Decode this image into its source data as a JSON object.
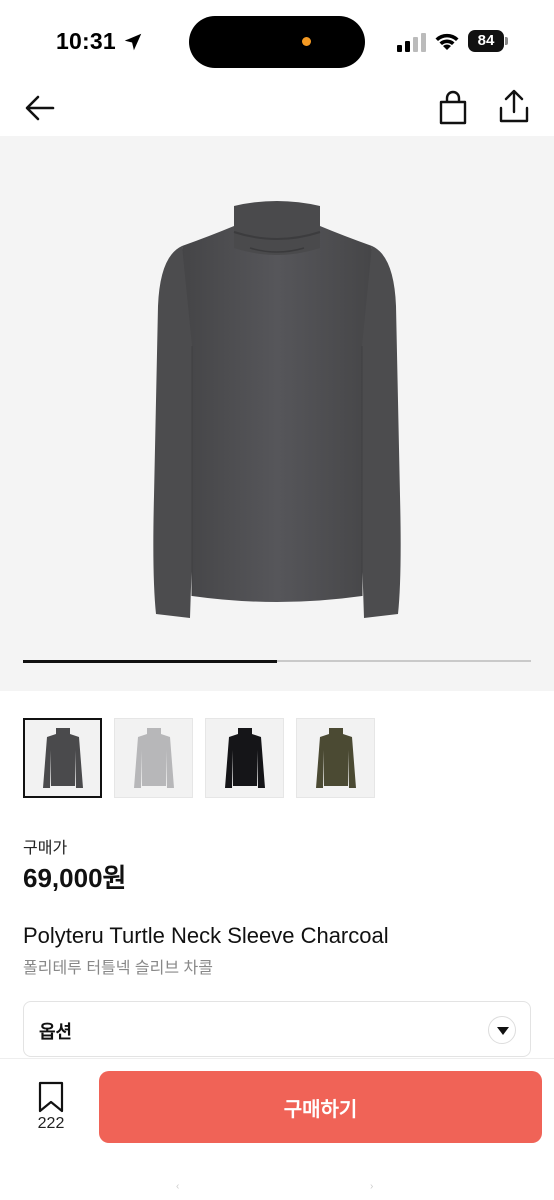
{
  "status_bar": {
    "time": "10:31",
    "battery": "84"
  },
  "header": {
    "back_icon": "arrow-left-icon",
    "bag_icon": "shopping-bag-icon",
    "share_icon": "share-icon"
  },
  "gallery": {
    "progress": 0.5,
    "thumbnails": [
      {
        "color": "Charcoal",
        "hex": "#4a4a4c",
        "selected": true
      },
      {
        "color": "Gray",
        "hex": "#b7b7b9",
        "selected": false
      },
      {
        "color": "Black",
        "hex": "#151518",
        "selected": false
      },
      {
        "color": "Khaki",
        "hex": "#4b4a33",
        "selected": false
      }
    ]
  },
  "product": {
    "price_label": "구매가",
    "price": "69,000원",
    "name_en": "Polyteru Turtle Neck Sleeve Charcoal",
    "name_ko": "폴리테루 터틀넥 슬리브 차콜"
  },
  "option": {
    "label": "옵션"
  },
  "bottom_bar": {
    "bookmark_count": "222",
    "buy_label": "구매하기"
  },
  "colors": {
    "accent": "#f06357",
    "hero_bg": "#f4f4f4"
  }
}
